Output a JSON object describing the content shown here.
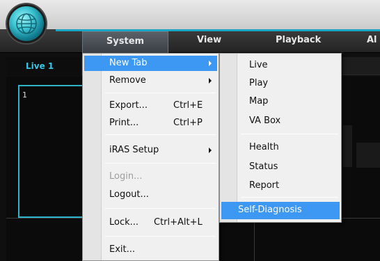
{
  "menubar": {
    "items": [
      {
        "label": "System"
      },
      {
        "label": "View"
      },
      {
        "label": "Playback"
      },
      {
        "label": "Al"
      }
    ]
  },
  "tabs": {
    "active_label": "Live 1"
  },
  "viewport": {
    "cell_label": "1"
  },
  "system_menu": {
    "new_tab": "New Tab",
    "remove": "Remove",
    "export": "Export...",
    "export_shortcut": "Ctrl+E",
    "print": "Print...",
    "print_shortcut": "Ctrl+P",
    "iras_setup": "iRAS Setup",
    "login": "Login...",
    "logout": "Logout...",
    "lock": "Lock...",
    "lock_shortcut": "Ctrl+Alt+L",
    "exit": "Exit..."
  },
  "new_tab_menu": {
    "live": "Live",
    "play": "Play",
    "map": "Map",
    "va_box": "VA Box",
    "health": "Health",
    "status": "Status",
    "report": "Report",
    "self_diagnosis": "Self-Diagnosis"
  },
  "colors": {
    "accent": "#2fb3c8",
    "menu_highlight": "#3c98f3",
    "tab_text": "#35c8e6"
  },
  "icons": {
    "logo": "globe-logo-icon",
    "submenu": "chevron-right-icon"
  }
}
